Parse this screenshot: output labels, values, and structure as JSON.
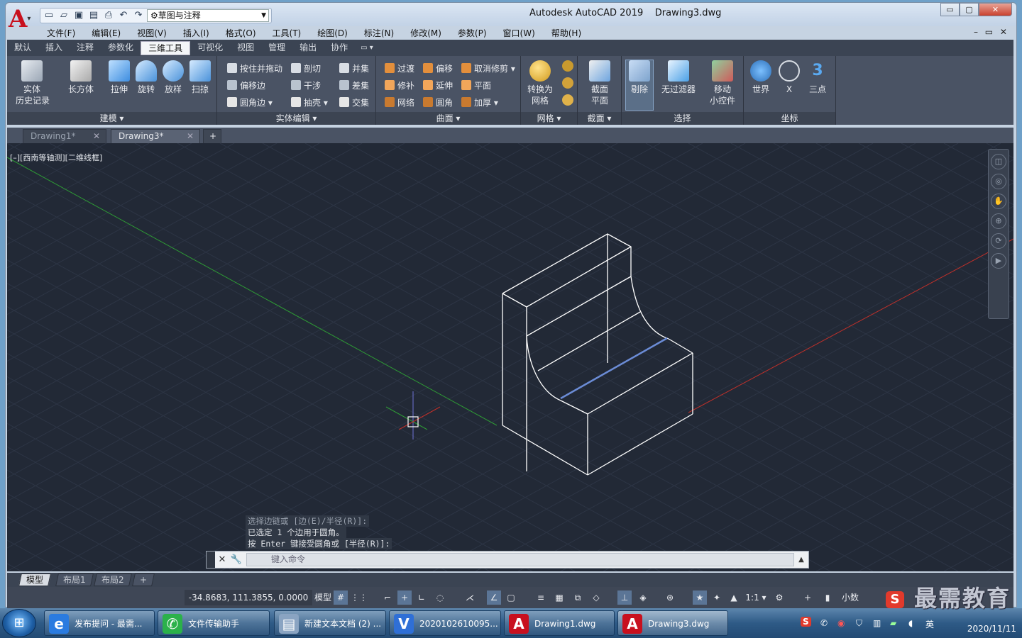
{
  "titlebar": {
    "logo_letter": "A",
    "workspace": "草图与注释",
    "title": "Autodesk AutoCAD 2019    Drawing3.dwg",
    "min": "▭",
    "max": "▢",
    "close": "✕"
  },
  "menu": [
    "文件(F)",
    "编辑(E)",
    "视图(V)",
    "插入(I)",
    "格式(O)",
    "工具(T)",
    "绘图(D)",
    "标注(N)",
    "修改(M)",
    "参数(P)",
    "窗口(W)",
    "帮助(H)"
  ],
  "mdi_controls": "– ▭ ✕",
  "ribbon_tabs": [
    "默认",
    "插入",
    "注释",
    "参数化",
    "三维工具",
    "可视化",
    "视图",
    "管理",
    "输出",
    "协作"
  ],
  "active_tab": "三维工具",
  "panels": {
    "modeling": {
      "label": "建模 ▾",
      "history": "实体\n历史记录",
      "box": "长方体",
      "extrude": "拉伸",
      "revolve": "旋转",
      "loft": "放样",
      "sweep": "扫掠"
    },
    "solid_edit": {
      "label": "实体编辑 ▾",
      "items": [
        "按住并拖动",
        "偏移边",
        "圆角边 ▾",
        "剖切",
        "干涉",
        "抽壳 ▾",
        "并集",
        "差集",
        "交集"
      ]
    },
    "surface": {
      "label": "曲面 ▾",
      "items": [
        "过渡",
        "修补",
        "网络",
        "偏移",
        "延伸",
        "圆角",
        "取消修剪 ▾",
        "平面",
        "加厚 ▾"
      ]
    },
    "mesh": {
      "label": "网格 ▾",
      "convert": "转换为\n网格"
    },
    "section": {
      "label": "截面 ▾",
      "plane": "截面\n平面"
    },
    "selection": {
      "label": "选择",
      "culling": "剔除",
      "nofilter": "无过滤器",
      "gizmo": "移动\n小控件"
    },
    "coords": {
      "label": "坐标",
      "world": "世界",
      "x": "X",
      "three": "三点"
    }
  },
  "doc_tabs": [
    {
      "label": "Drawing1*"
    },
    {
      "label": "Drawing3*"
    }
  ],
  "doc_tab_close": "✕",
  "doc_tab_add": "+",
  "viewport_label": "[–][西南等轴测][二维线框]",
  "command_history": [
    "选择边链或 [边(E)/半径(R)]:",
    "已选定 1 个边用于圆角。",
    "按 Enter 键接受圆角或 [半径(R)]:"
  ],
  "command_placeholder": "键入命令",
  "layout_tabs": [
    "模型",
    "布局1",
    "布局2",
    "+"
  ],
  "status": {
    "coords": "-34.8683, 111.3855, 0.0000",
    "model": "模型",
    "scale": "1:1 ▾",
    "units": "小数"
  },
  "taskbar": [
    {
      "label": "发布提问 - 最需...",
      "icon": "e"
    },
    {
      "label": "文件传输助手",
      "icon": "✆"
    },
    {
      "label": "新建文本文档 (2) ...",
      "icon": "▤"
    },
    {
      "label": "2020102610095...",
      "icon": "V"
    },
    {
      "label": "Drawing1.dwg",
      "icon": "A"
    },
    {
      "label": "Drawing3.dwg",
      "icon": "A"
    }
  ],
  "tray": {
    "ime": "英",
    "date": "2020/11/11"
  },
  "watermark": "最需教育",
  "colors": {
    "viewport_bg": "#222936",
    "selected_edge": "#6b8cd6",
    "x_axis": "#c0302a",
    "y_axis": "#2e9a35"
  }
}
